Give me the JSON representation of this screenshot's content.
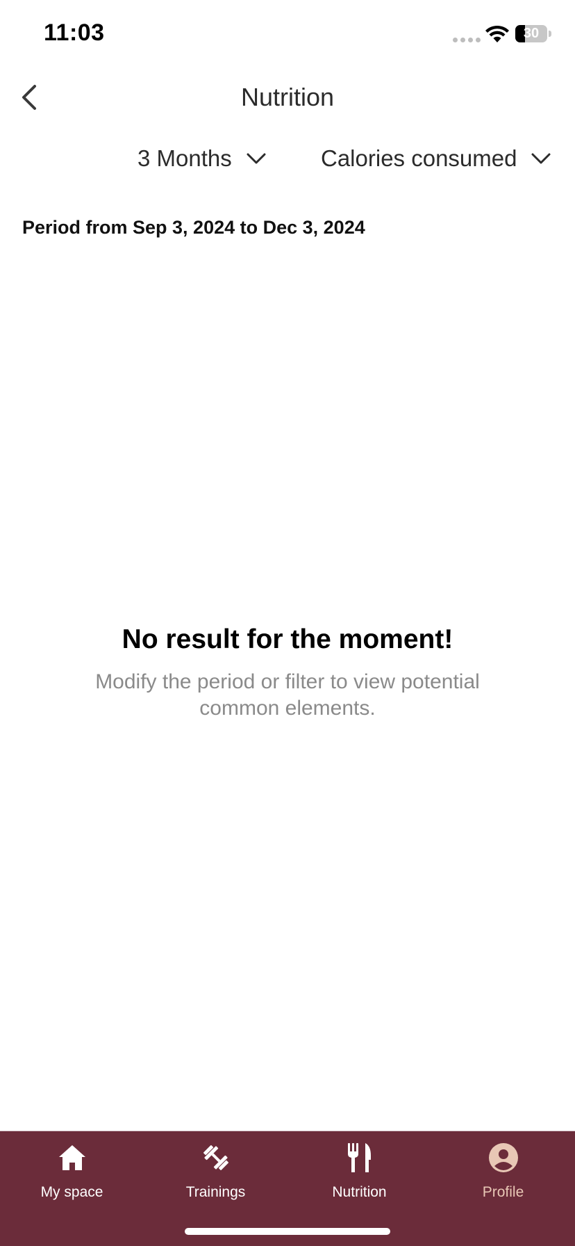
{
  "status_bar": {
    "time": "11:03",
    "battery_level": "30",
    "battery_fraction": 0.3
  },
  "header": {
    "title": "Nutrition",
    "back_icon": "chevron-left-icon"
  },
  "filters": {
    "period": {
      "label": "3 Months",
      "icon": "chevron-down-icon"
    },
    "metric": {
      "label": "Calories consumed",
      "icon": "chevron-down-icon"
    }
  },
  "period_range": "Period from Sep 3, 2024 to Dec 3, 2024",
  "empty_state": {
    "title": "No result for the moment!",
    "message": "Modify the period or filter to view potential common elements."
  },
  "bottom_nav": {
    "items": [
      {
        "label": "My space",
        "icon": "home-icon"
      },
      {
        "label": "Trainings",
        "icon": "dumbbell-icon"
      },
      {
        "label": "Nutrition",
        "icon": "fork-knife-icon"
      },
      {
        "label": "Profile",
        "icon": "profile-icon"
      }
    ],
    "active": "Profile"
  },
  "colors": {
    "nav_background": "#6b2c3a",
    "nav_active_label": "#e8c7b5",
    "secondary_text": "#8a8a8a"
  }
}
